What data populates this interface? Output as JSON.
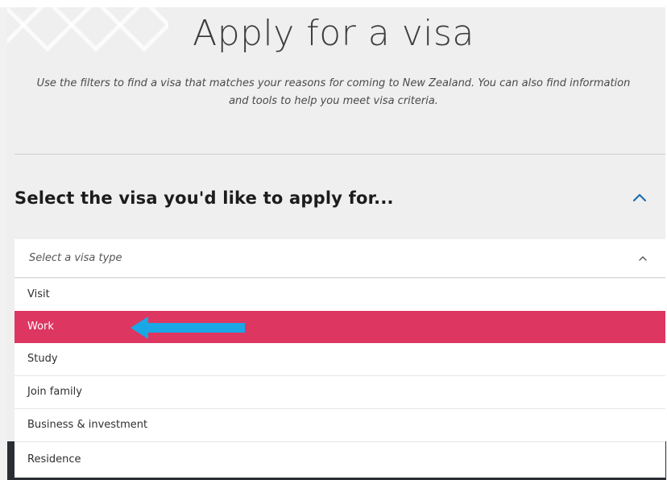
{
  "header": {
    "title": "Apply for a visa",
    "intro": "Use the filters to find a visa that matches your reasons for coming to New Zealand. You can also find information and tools to help you meet visa criteria."
  },
  "section": {
    "heading": "Select the visa you'd like to apply for...",
    "toggle_icon": "chevron-up-icon"
  },
  "visa_select": {
    "placeholder": "Select a visa type",
    "chevron_icon": "chevron-up-icon",
    "expanded": true,
    "options": [
      {
        "label": "Visit"
      },
      {
        "label": "Work"
      },
      {
        "label": "Study"
      },
      {
        "label": "Join family"
      },
      {
        "label": "Business & investment"
      },
      {
        "label": "Residence"
      }
    ],
    "highlighted_index": 1
  },
  "annotation": {
    "icon": "left-arrow-icon",
    "points_to": "Work"
  },
  "colors": {
    "accent_blue": "#1f6fb2",
    "highlight": "#dc3661",
    "arrow": "#1aa7e6",
    "page_bg": "#efefef",
    "dark_strip": "#2a2d34"
  }
}
